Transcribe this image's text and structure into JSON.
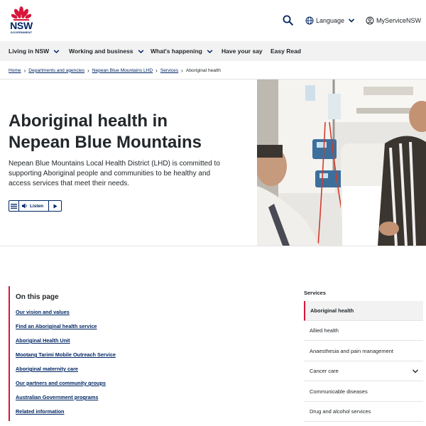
{
  "header": {
    "logo": {
      "wordmark": "NSW",
      "subtext": "GOVERNMENT"
    },
    "search_icon": "search-icon",
    "language_label": "Language",
    "myservice_label": "MyServiceNSW"
  },
  "nav": {
    "items": [
      {
        "label": "Living in NSW",
        "has_dropdown": true
      },
      {
        "label": "Working and business",
        "has_dropdown": true
      },
      {
        "label": "What's happening",
        "has_dropdown": true
      },
      {
        "label": "Have your say",
        "has_dropdown": false
      },
      {
        "label": "Easy Read",
        "has_dropdown": false
      }
    ]
  },
  "breadcrumb": {
    "items": [
      {
        "label": "Home",
        "link": true
      },
      {
        "label": "Departments and agencies",
        "link": true
      },
      {
        "label": "Nepean Blue Mountains LHD",
        "link": true
      },
      {
        "label": "Services",
        "link": true
      },
      {
        "label": "Aboriginal health",
        "link": false
      }
    ]
  },
  "hero": {
    "title_line1": "Aboriginal health in",
    "title_line2": "Nepean Blue Mountains",
    "intro": "Nepean Blue Mountains Local Health District (LHD) is committed to supporting Aboriginal people and communities to be healthy and access services that meet their needs.",
    "listen_label": "Listen"
  },
  "on_this_page": {
    "title": "On this page",
    "links": [
      "Our vision and values",
      "Find an Aboriginal health service",
      "Aboriginal Health Unit",
      "Mootang Tarimi Mobile Outreach Service",
      "Aboriginal maternity care",
      "Our partners and community groups",
      "Australian Government programs",
      "Related information"
    ]
  },
  "services": {
    "heading": "Services",
    "items": [
      {
        "label": "Aboriginal health",
        "active": true,
        "expandable": false
      },
      {
        "label": "Allied health",
        "active": false,
        "expandable": false
      },
      {
        "label": "Anaesthesia and pain management",
        "active": false,
        "expandable": false
      },
      {
        "label": "Cancer care",
        "active": false,
        "expandable": true
      },
      {
        "label": "Communicable diseases",
        "active": false,
        "expandable": false
      },
      {
        "label": "Drug and alcohol services",
        "active": false,
        "expandable": false
      }
    ]
  },
  "colors": {
    "brand_navy": "#002664",
    "accent_red": "#d7153a",
    "nav_bg": "#f2f2f2",
    "text": "#22272b"
  }
}
